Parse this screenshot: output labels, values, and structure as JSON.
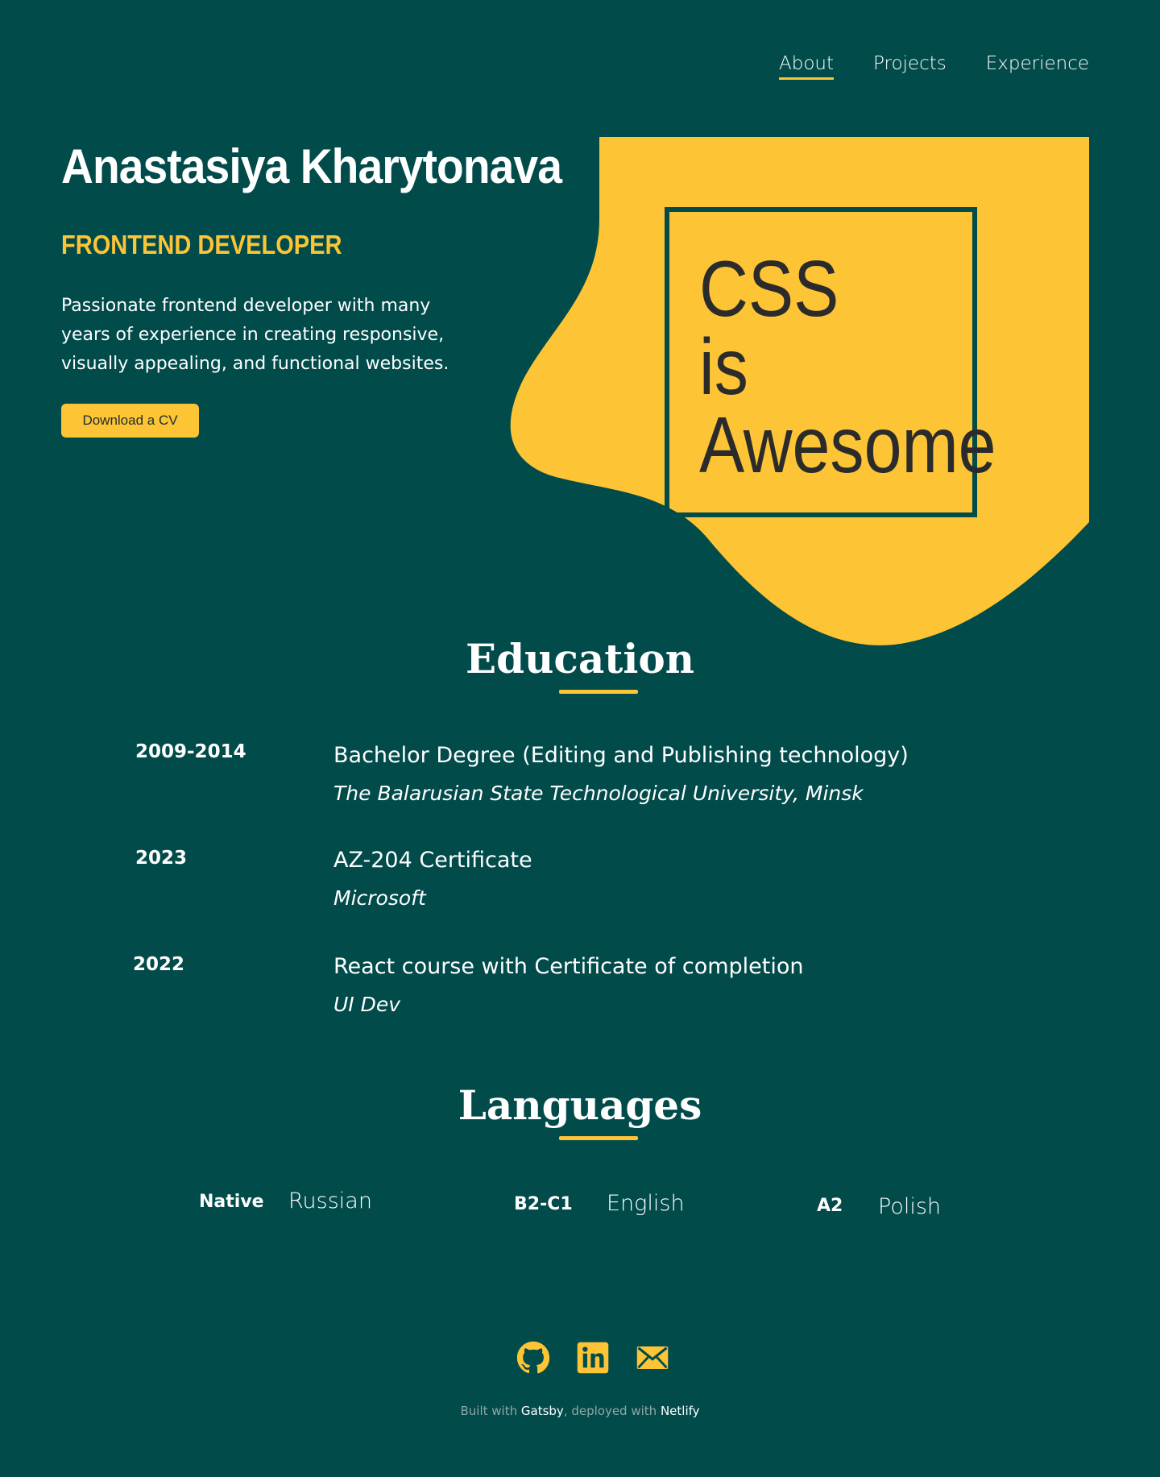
{
  "nav": {
    "items": [
      {
        "label": "About"
      },
      {
        "label": "Projects"
      },
      {
        "label": "Experience"
      }
    ]
  },
  "hero": {
    "name": "Anastasiya Kharytonava",
    "role": "FRONTEND DEVELOPER",
    "description": "Passionate frontend developer with many years of experience in creating responsive, visually appealing, and functional websites.",
    "cv_button": "Download a CV",
    "graphic_lines": [
      "CSS",
      "is",
      "Awesome"
    ]
  },
  "education": {
    "title": "Education",
    "items": [
      {
        "year": "2009-2014",
        "title": "Bachelor Degree (Editing and Publishing technology)",
        "institution": "The Balarusian State Technological University, Minsk"
      },
      {
        "year": "2023",
        "title": "AZ-204 Certificate",
        "institution": "Microsoft"
      },
      {
        "year": "2022",
        "title": "React course with Certificate of completion",
        "institution": "UI Dev"
      }
    ]
  },
  "languages": {
    "title": "Languages",
    "items": [
      {
        "level": "Native",
        "name": "Russian"
      },
      {
        "level": "B2-C1",
        "name": "English"
      },
      {
        "level": "A2",
        "name": "Polish"
      }
    ]
  },
  "socials": [
    {
      "icon": "github-icon"
    },
    {
      "icon": "linkedin-icon"
    },
    {
      "icon": "mail-icon"
    }
  ],
  "footer": {
    "built_prefix": "Built with",
    "gatsby": "Gatsby",
    "deployed_prefix": ", deployed with",
    "netlify": "Netlify"
  },
  "colors": {
    "background": "#024b4b",
    "accent": "#fdc435",
    "text": "#ffffff"
  }
}
